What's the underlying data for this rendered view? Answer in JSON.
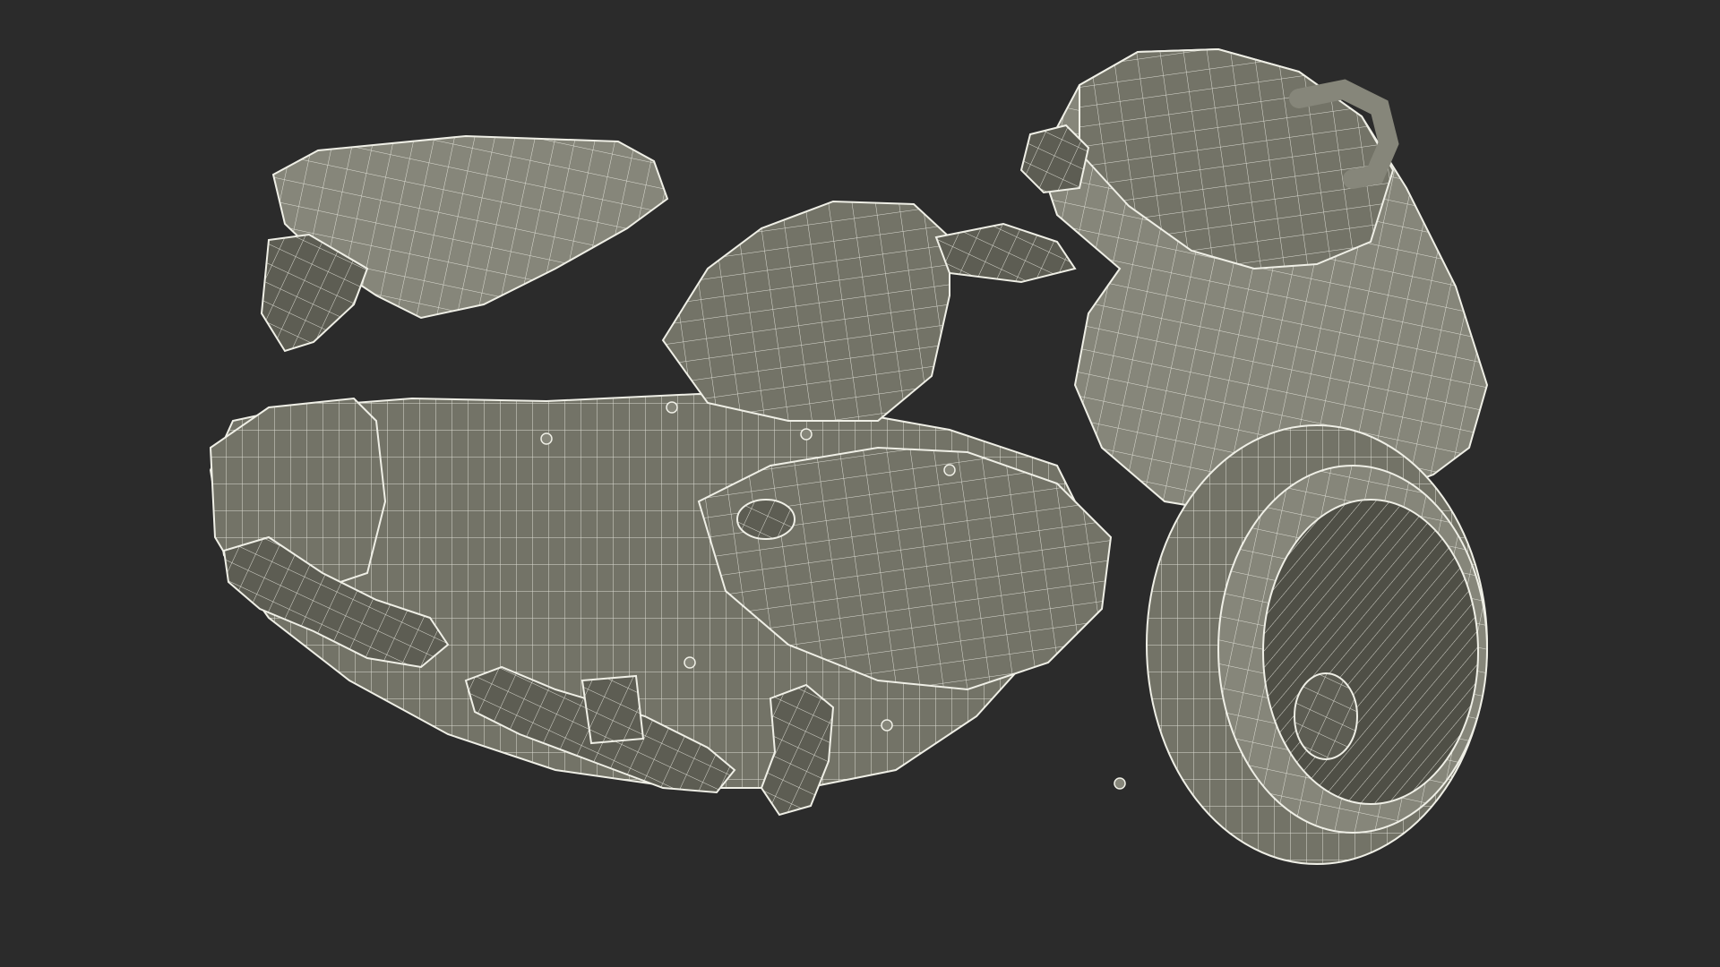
{
  "image": {
    "title": "",
    "caption": ""
  },
  "colors": {
    "background": "#2b2b2b",
    "body_fill": "#737367",
    "body_fill_light": "#86867a",
    "body_fill_dark": "#5d5d53",
    "wire": "#efefe6",
    "intake_dark": "#4f4f46"
  }
}
